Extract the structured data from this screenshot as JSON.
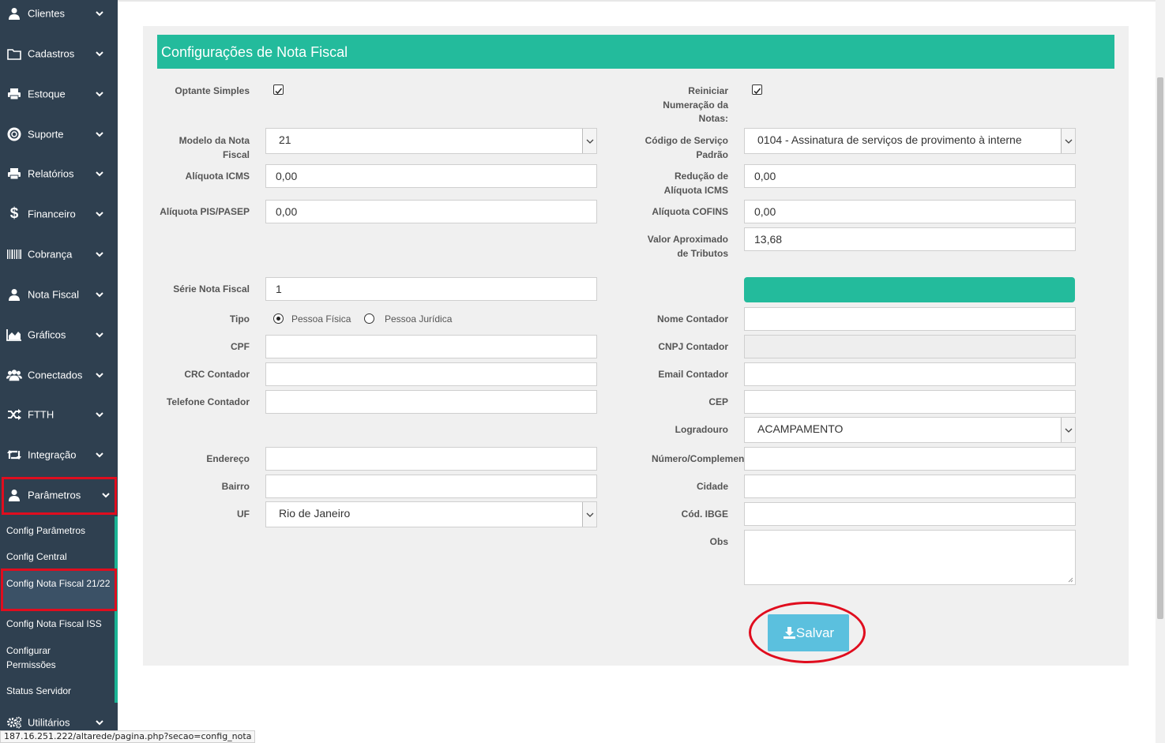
{
  "sidebar": {
    "items": [
      {
        "label": "Clientes",
        "icon": "user-icon"
      },
      {
        "label": "Cadastros",
        "icon": "folder-icon"
      },
      {
        "label": "Estoque",
        "icon": "printer-icon"
      },
      {
        "label": "Suporte",
        "icon": "lifebuoy-icon"
      },
      {
        "label": "Relatórios",
        "icon": "printer-icon"
      },
      {
        "label": "Financeiro",
        "icon": "dollar-icon"
      },
      {
        "label": "Cobrança",
        "icon": "barcode-icon"
      },
      {
        "label": "Nota Fiscal",
        "icon": "user-icon"
      },
      {
        "label": "Gráficos",
        "icon": "area-chart-icon"
      },
      {
        "label": "Conectados",
        "icon": "users-icon"
      },
      {
        "label": "FTTH",
        "icon": "random-icon"
      },
      {
        "label": "Integração",
        "icon": "retweet-icon"
      },
      {
        "label": "Parâmetros",
        "icon": "user-icon"
      },
      {
        "label": "Utilitários",
        "icon": "gears-icon"
      }
    ],
    "submenu": [
      {
        "label": "Config Parâmetros"
      },
      {
        "label": "Config Central"
      },
      {
        "label": "Config Nota Fiscal 21/22"
      },
      {
        "label": "Config Nota Fiscal ISS"
      },
      {
        "label": "Configurar Permissões"
      },
      {
        "label": "Status Servidor"
      }
    ]
  },
  "panel": {
    "title": "Configurações de Nota Fiscal"
  },
  "form": {
    "optante_simples_label": "Optante Simples",
    "optante_simples_checked": true,
    "reiniciar_label": "Reiniciar Numeração da Notas:",
    "reiniciar_checked": true,
    "modelo_label": "Modelo da Nota Fiscal",
    "modelo_value": "21",
    "codigo_servico_label": "Código de Serviço Padrão",
    "codigo_servico_value": "0104 - Assinatura de serviços de provimento à interne",
    "aliquota_icms_label": "Alíquota ICMS",
    "aliquota_icms_value": "0,00",
    "reducao_icms_label": "Redução de Alíquota ICMS",
    "reducao_icms_value": "0,00",
    "aliquota_pis_label": "Alíquota PIS/PASEP",
    "aliquota_pis_value": "0,00",
    "aliquota_cofins_label": "Alíquota COFINS",
    "aliquota_cofins_value": "0,00",
    "valor_tributos_label": "Valor Aproximado de Tributos",
    "valor_tributos_value": "13,68",
    "serie_label": "Série Nota Fiscal",
    "serie_value": "1",
    "tipo_label": "Tipo",
    "tipo_options": [
      "Pessoa Física",
      "Pessoa Jurídica"
    ],
    "tipo_selected": "Pessoa Física",
    "nome_contador_label": "Nome Contador",
    "nome_contador_value": "",
    "cpf_label": "CPF",
    "cpf_value": "",
    "cnpj_contador_label": "CNPJ Contador",
    "cnpj_contador_value": "",
    "crc_label": "CRC Contador",
    "crc_value": "",
    "email_contador_label": "Email Contador",
    "email_contador_value": "",
    "telefone_label": "Telefone Contador",
    "telefone_value": "",
    "cep_label": "CEP",
    "cep_value": "",
    "logradouro_label": "Logradouro",
    "logradouro_value": "ACAMPAMENTO",
    "endereco_label": "Endereço",
    "endereco_value": "",
    "numero_label": "Número/Complemento",
    "numero_value": "",
    "bairro_label": "Bairro",
    "bairro_value": "",
    "cidade_label": "Cidade",
    "cidade_value": "",
    "uf_label": "UF",
    "uf_value": "Rio de Janeiro",
    "ibge_label": "Cód. IBGE",
    "ibge_value": "",
    "obs_label": "Obs",
    "obs_value": ""
  },
  "save_button": {
    "label": "Salvar",
    "icon": "download-icon"
  },
  "status_bar": {
    "url": "187.16.251.222/altarede/pagina.php?secao=config_nota"
  },
  "colors": {
    "sidebar": "#2f4050",
    "accent": "#23bb9c",
    "button": "#5bc0de",
    "highlight": "#e00d1e"
  }
}
